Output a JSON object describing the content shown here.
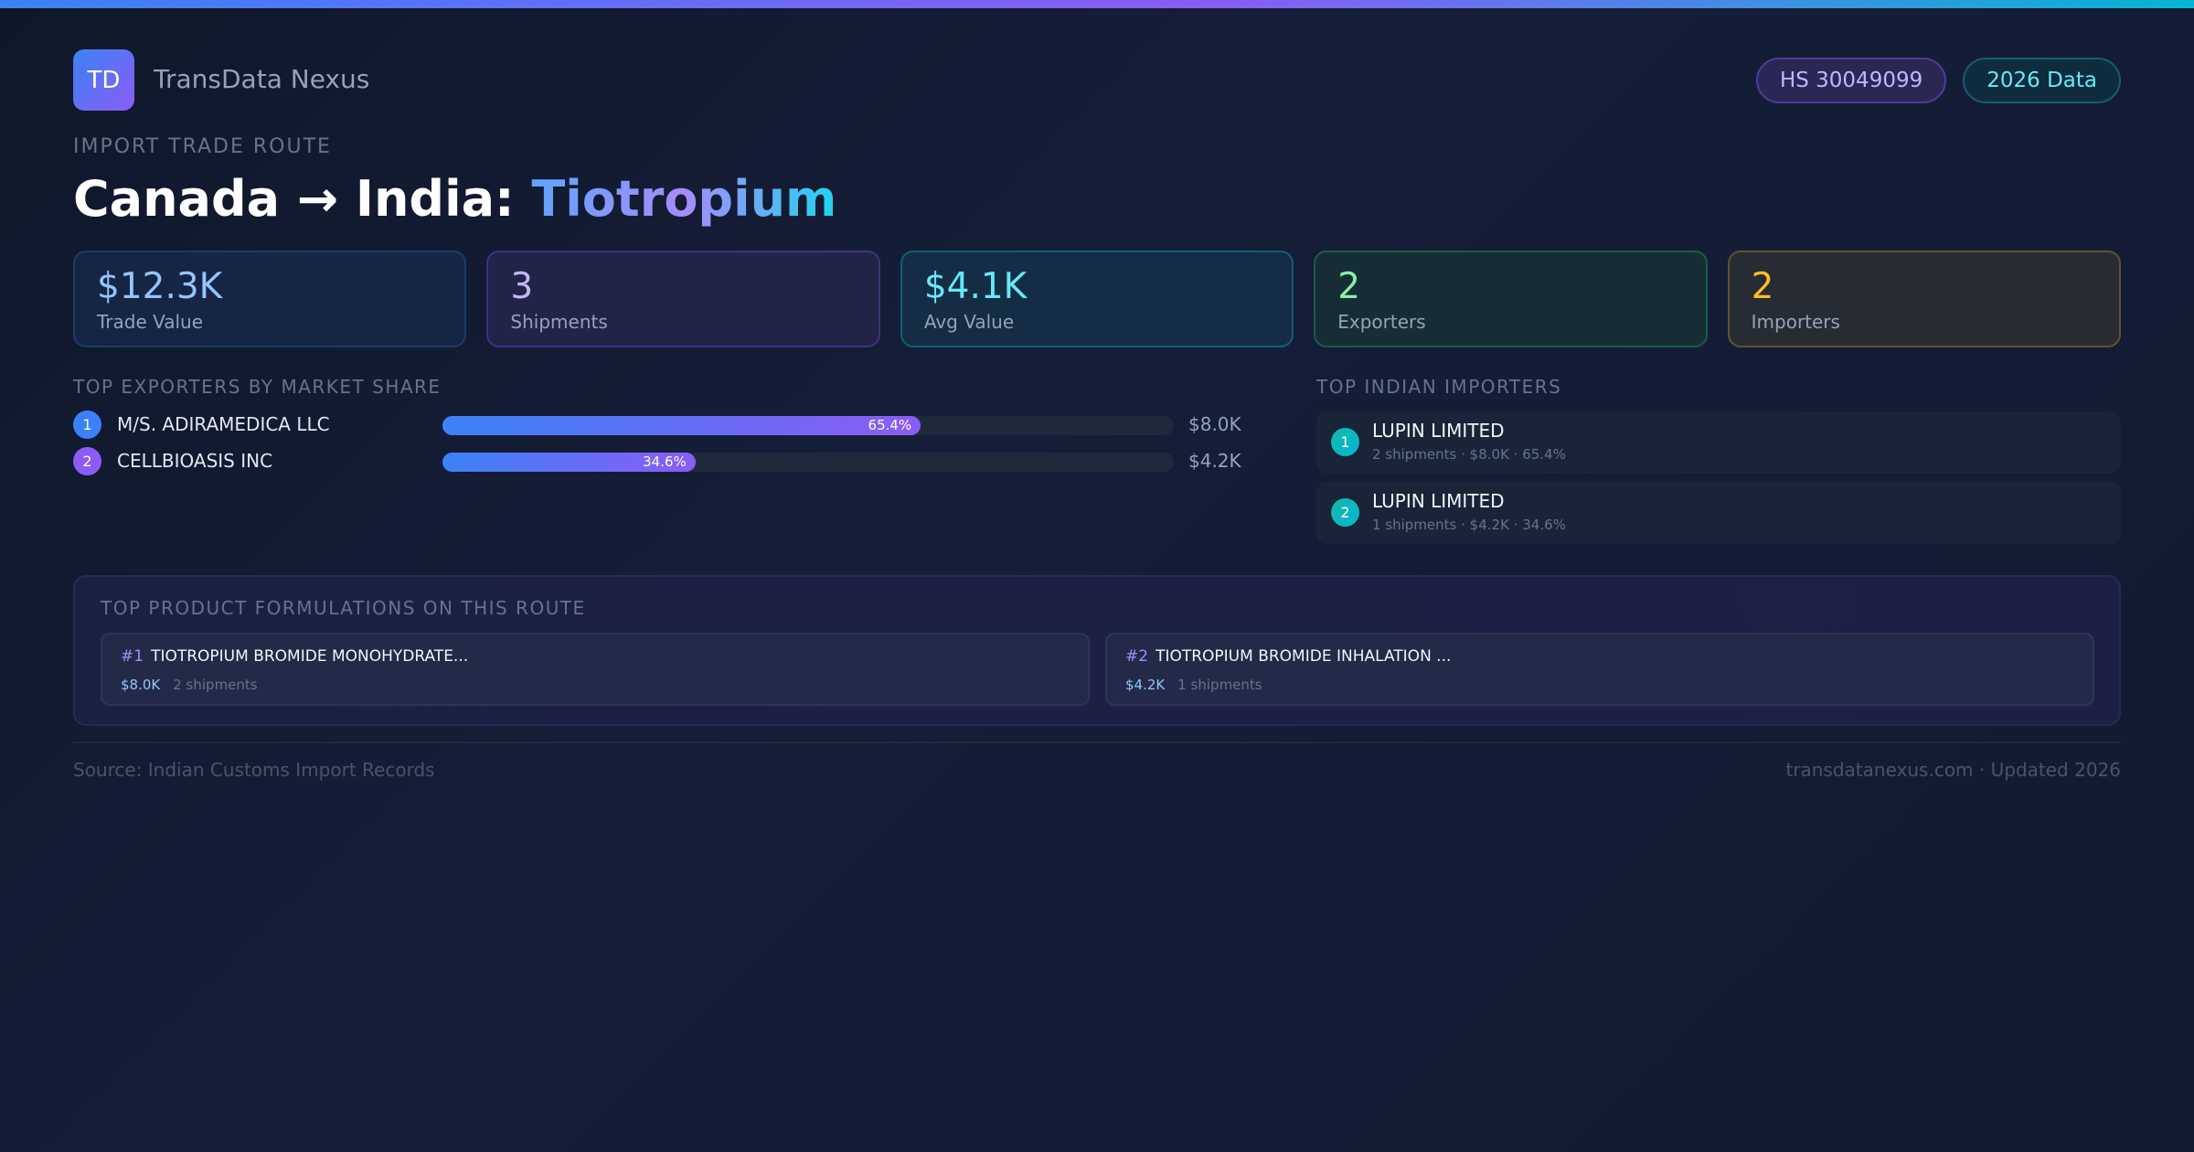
{
  "brand": {
    "logo": "TD",
    "name": "TransData Nexus"
  },
  "badges": {
    "hs": "HS 30049099",
    "year": "2026 Data"
  },
  "route": {
    "eyebrow": "IMPORT TRADE ROUTE",
    "title_prefix": "Canada → India: ",
    "title_product": "Tiotropium"
  },
  "stats": [
    {
      "value": "$12.3K",
      "label": "Trade Value"
    },
    {
      "value": "3",
      "label": "Shipments"
    },
    {
      "value": "$4.1K",
      "label": "Avg Value"
    },
    {
      "value": "2",
      "label": "Exporters"
    },
    {
      "value": "2",
      "label": "Importers"
    }
  ],
  "exporters": {
    "heading": "TOP EXPORTERS BY MARKET SHARE",
    "items": [
      {
        "rank": "1",
        "name": "M/S. ADIRAMEDICA LLC",
        "share_label": "65.4%",
        "share": 65.4,
        "value": "$8.0K"
      },
      {
        "rank": "2",
        "name": "CELLBIOASIS INC",
        "share_label": "34.6%",
        "share": 34.6,
        "value": "$4.2K"
      }
    ]
  },
  "importers": {
    "heading": "TOP INDIAN IMPORTERS",
    "items": [
      {
        "rank": "1",
        "name": "LUPIN LIMITED",
        "meta": "2 shipments · $8.0K · 65.4%"
      },
      {
        "rank": "2",
        "name": "LUPIN LIMITED",
        "meta": "1 shipments · $4.2K · 34.6%"
      }
    ]
  },
  "formulations": {
    "heading": "TOP PRODUCT FORMULATIONS ON THIS ROUTE",
    "items": [
      {
        "rank": "#1",
        "name": "TIOTROPIUM BROMIDE MONOHYDRATE...",
        "value": "$8.0K",
        "shipments": "2 shipments"
      },
      {
        "rank": "#2",
        "name": "TIOTROPIUM BROMIDE INHALATION ...",
        "value": "$4.2K",
        "shipments": "1 shipments"
      }
    ]
  },
  "footer": {
    "source": "Source: Indian Customs Import Records",
    "site": "transdatanexus.com · Updated 2026"
  }
}
